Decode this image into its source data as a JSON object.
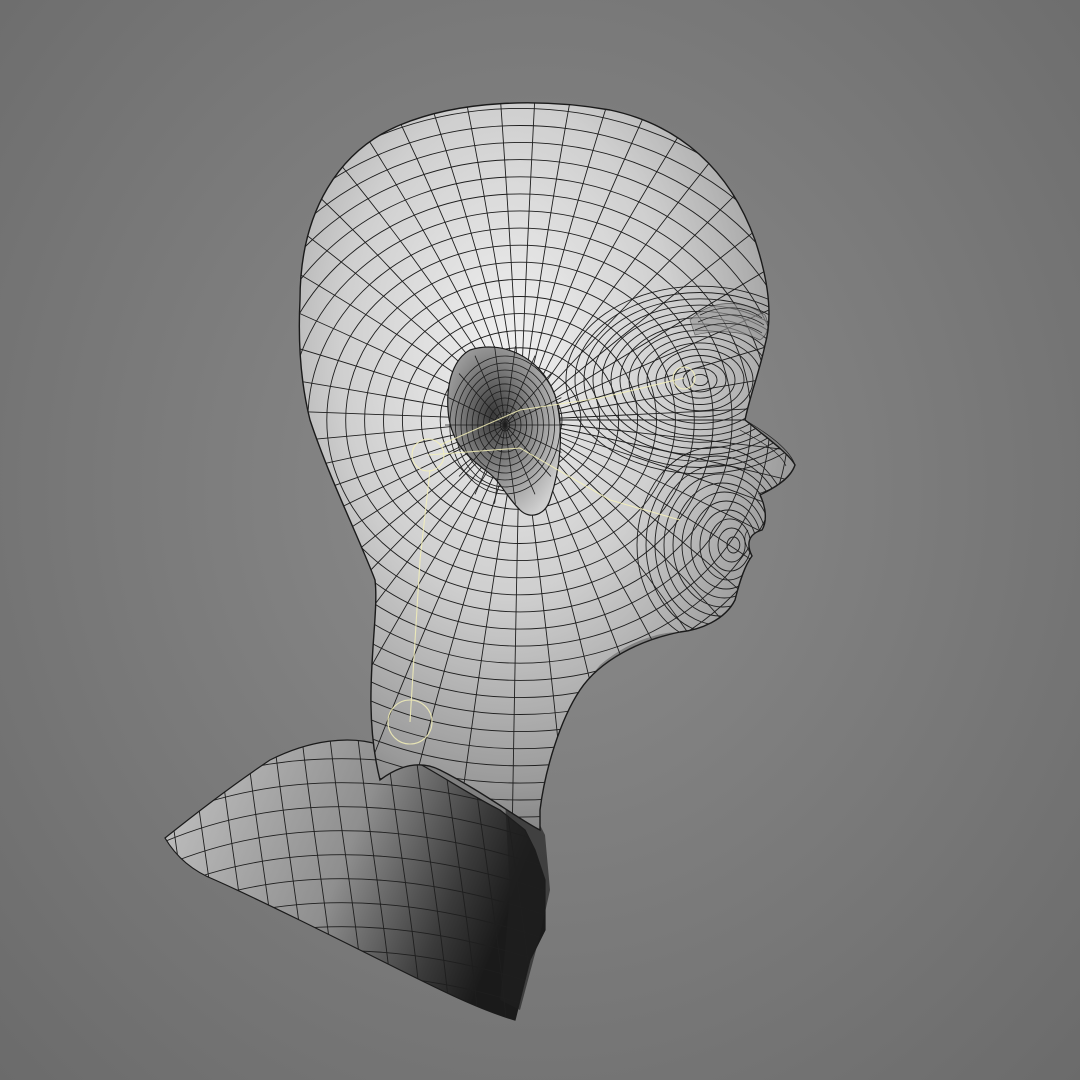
{
  "viewport": {
    "background_color": "#7d7d7d",
    "mesh_shading_light": "#e4e4e4",
    "mesh_shading_dark": "#2a2a2a",
    "wire_color": "#1e1e1e",
    "helper_color": "#f4f0b8"
  },
  "scene": {
    "object": "head-mesh",
    "display_mode": "shaded-wireframe",
    "view": "side"
  }
}
